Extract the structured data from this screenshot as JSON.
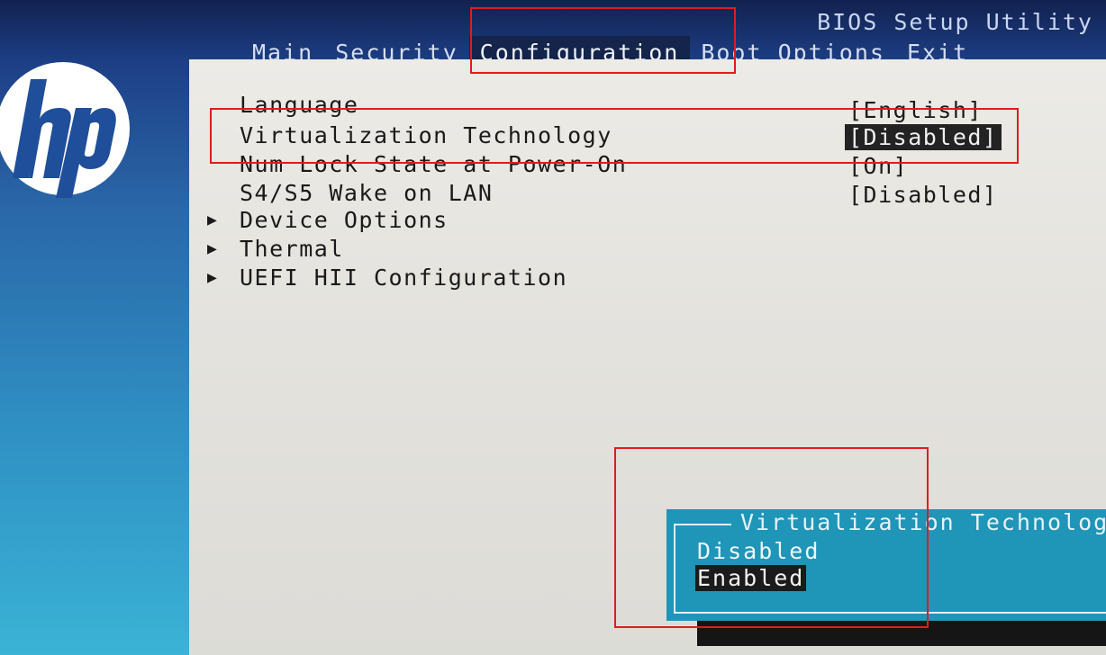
{
  "header": {
    "title": "BIOS Setup Utility",
    "menu": [
      {
        "label": "Main",
        "active": false
      },
      {
        "label": "Security",
        "active": false
      },
      {
        "label": "Configuration",
        "active": true
      },
      {
        "label": "Boot Options",
        "active": false
      },
      {
        "label": "Exit",
        "active": false
      }
    ]
  },
  "settings": [
    {
      "label": "Language",
      "value": "[English]"
    },
    {
      "label": "Virtualization Technology",
      "value": "[Disabled]",
      "selected": true
    },
    {
      "label": "Num Lock State at Power-On",
      "value": "[On]"
    },
    {
      "label": "S4/S5 Wake on LAN",
      "value": "[Disabled]"
    }
  ],
  "submenus": [
    {
      "label": "Device Options"
    },
    {
      "label": "Thermal"
    },
    {
      "label": "UEFI HII Configuration"
    }
  ],
  "popup": {
    "title": "Virtualization Technolog",
    "options": [
      "Disabled",
      "Enabled"
    ],
    "selected_option": "Enabled"
  },
  "colors": {
    "annotation": "#e31b1b",
    "popup_bg": "#1f95b8",
    "panel_bg": "#e6e5e0",
    "highlight": "#232323"
  }
}
